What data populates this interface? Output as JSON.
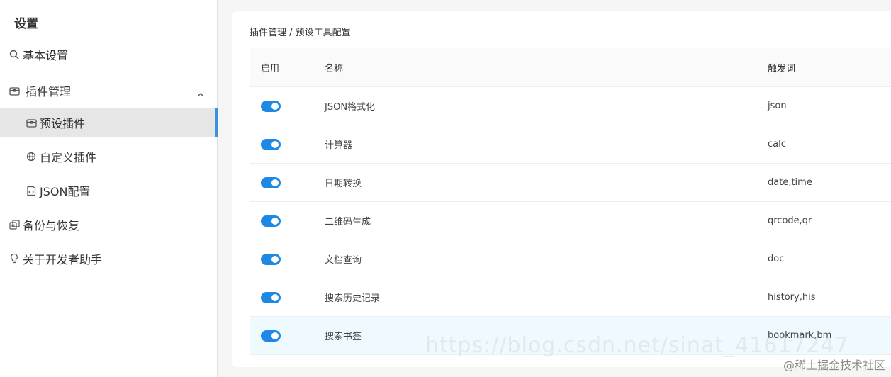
{
  "sidebar": {
    "title": "设置",
    "items": {
      "basic": "基本设置",
      "plugins": "插件管理",
      "preset": "预设插件",
      "custom": "自定义插件",
      "json": "JSON配置",
      "backup": "备份与恢复",
      "about": "关于开发者助手"
    }
  },
  "main": {
    "breadcrumb": "插件管理 / 预设工具配置",
    "columns": {
      "enabled": "启用",
      "name": "名称",
      "trigger": "触发词"
    },
    "rows": [
      {
        "enabled": true,
        "name": "JSON格式化",
        "trigger": "json"
      },
      {
        "enabled": true,
        "name": "计算器",
        "trigger": "calc"
      },
      {
        "enabled": true,
        "name": "日期转换",
        "trigger": "date,time"
      },
      {
        "enabled": true,
        "name": "二维码生成",
        "trigger": "qrcode,qr"
      },
      {
        "enabled": true,
        "name": "文档查询",
        "trigger": "doc"
      },
      {
        "enabled": true,
        "name": "搜索历史记录",
        "trigger": "history,his"
      },
      {
        "enabled": true,
        "name": "搜索书签",
        "trigger": "bookmark,bm"
      }
    ]
  },
  "watermark": {
    "brand": "@稀土掘金技术社区",
    "url": "https://blog.csdn.net/sinat_41617247"
  },
  "colors": {
    "accent": "#1e88e5",
    "active_bar": "#3d8fe0",
    "highlight_row": "#eefaff"
  }
}
